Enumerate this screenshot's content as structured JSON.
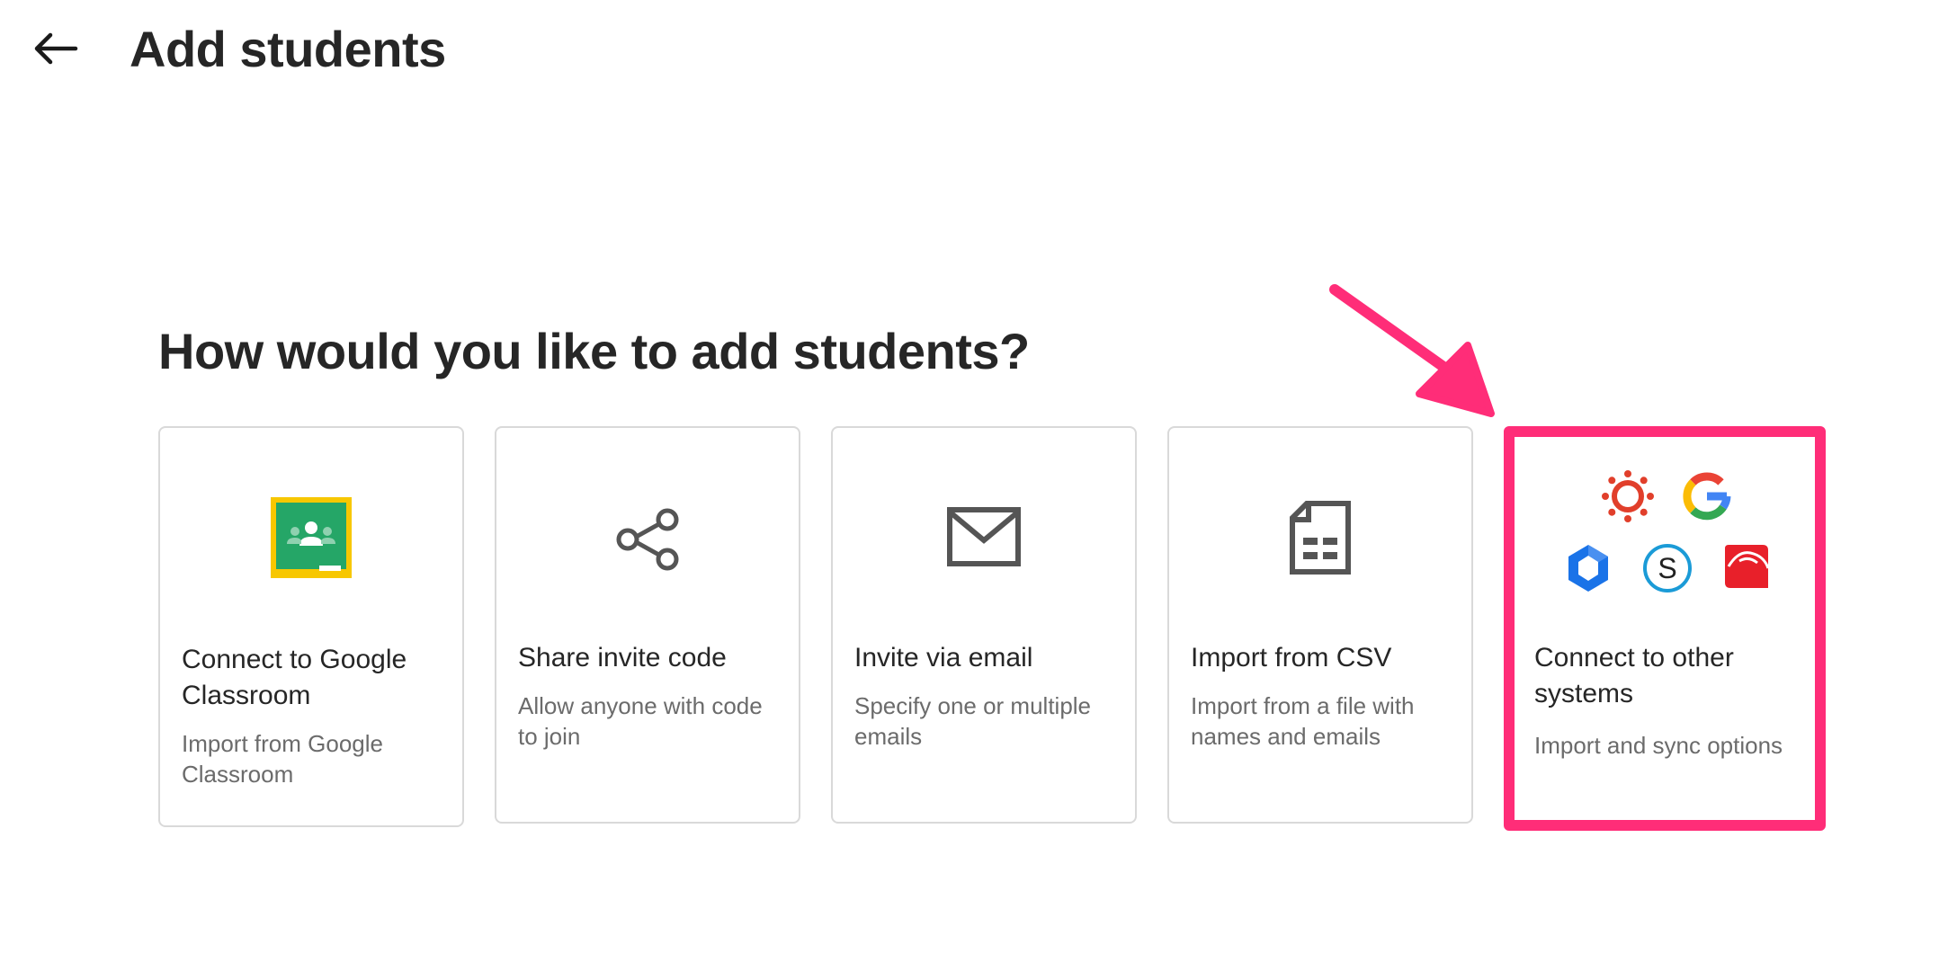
{
  "header": {
    "title": "Add students",
    "back_icon": "arrow-left-icon"
  },
  "main": {
    "question": "How would you like to add students?",
    "options": [
      {
        "title": "Connect to Google Classroom",
        "description": "Import from Google Classroom",
        "icon": "google-classroom-icon"
      },
      {
        "title": "Share invite code",
        "description": "Allow anyone with code to join",
        "icon": "share-icon"
      },
      {
        "title": "Invite via email",
        "description": "Specify one or multiple emails",
        "icon": "mail-icon"
      },
      {
        "title": "Import from CSV",
        "description": "Import from a file with names and emails",
        "icon": "csv-file-icon"
      },
      {
        "title": "Connect to other systems",
        "description": "Import and sync options",
        "icons": [
          "canvas-logo-icon",
          "google-logo-icon",
          "clever-logo-icon",
          "schoology-logo-icon",
          "schoolnet-logo-icon"
        ]
      }
    ]
  },
  "colors": {
    "highlight": "#ff2d78",
    "card_border": "#d9d9d9",
    "text_primary": "#262626",
    "text_secondary": "#6b6b6b"
  }
}
